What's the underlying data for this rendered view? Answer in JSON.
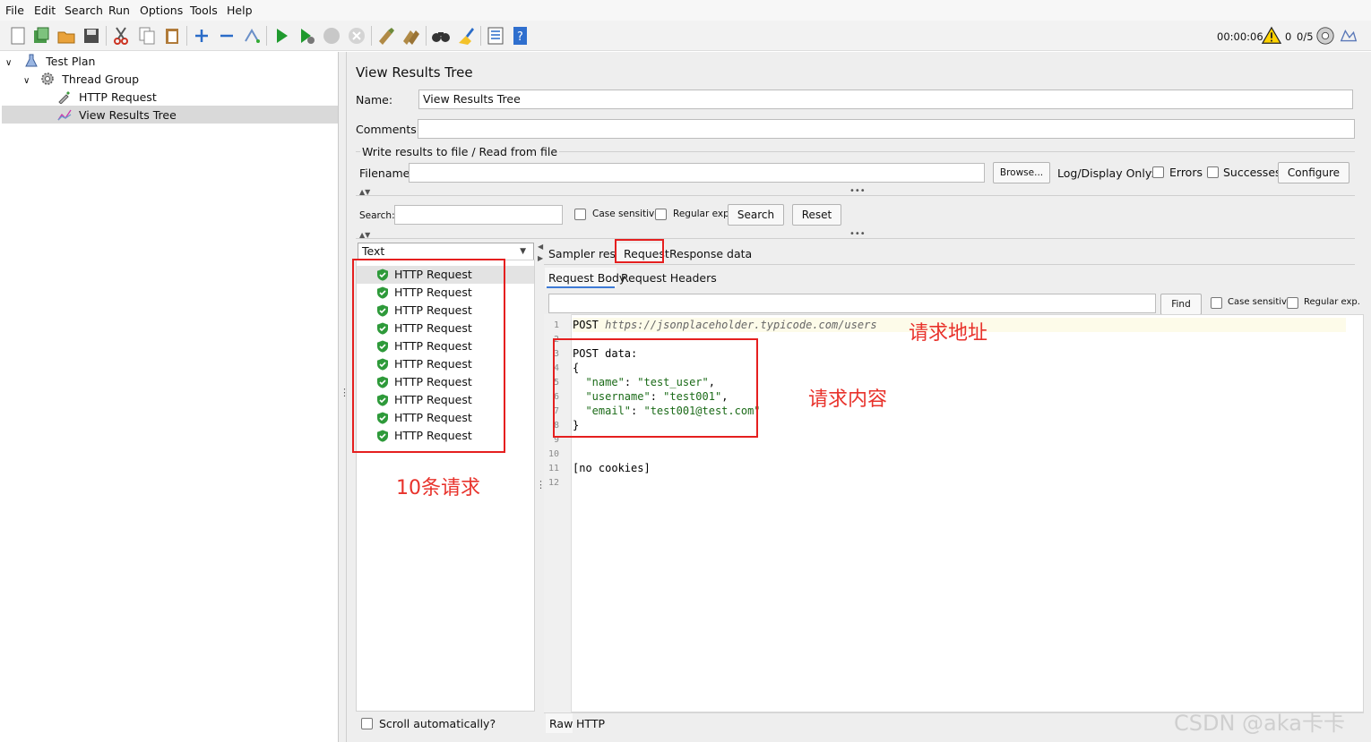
{
  "menu": [
    "File",
    "Edit",
    "Search",
    "Run",
    "Options",
    "Tools",
    "Help"
  ],
  "toolbar": {
    "timer": "00:00:06",
    "warnings": "0",
    "threads": "0/5"
  },
  "tree": {
    "test_plan": "Test Plan",
    "thread_group": "Thread Group",
    "http_request": "HTTP Request",
    "view_results_tree": "View Results Tree"
  },
  "panel": {
    "title": "View Results Tree",
    "name_label": "Name:",
    "name_value": "View Results Tree",
    "comments_label": "Comments:",
    "comments_value": "",
    "file_section": "Write results to file / Read from file",
    "filename_label": "Filename",
    "filename_value": "",
    "browse_button": "Browse...",
    "log_display_only": "Log/Display Only:",
    "errors_label": "Errors",
    "successes_label": "Successes",
    "configure_button": "Configure"
  },
  "search": {
    "label": "Search:",
    "value": "",
    "case_sensitive": "Case sensitive",
    "regular_exp": "Regular exp.",
    "search_button": "Search",
    "reset_button": "Reset"
  },
  "renderer": {
    "selected": "Text"
  },
  "results": [
    "HTTP Request",
    "HTTP Request",
    "HTTP Request",
    "HTTP Request",
    "HTTP Request",
    "HTTP Request",
    "HTTP Request",
    "HTTP Request",
    "HTTP Request",
    "HTTP Request"
  ],
  "scroll_auto": "Scroll automatically?",
  "tabs": {
    "sampler_result": "Sampler result",
    "request": "Request",
    "response_data": "Response data"
  },
  "subtabs": {
    "request_body": "Request Body",
    "request_headers": "Request Headers"
  },
  "find": {
    "value": "",
    "find_button": "Find",
    "case_sensitive": "Case sensitive",
    "regular_exp": "Regular exp."
  },
  "code": {
    "line_numbers": [
      "1",
      "2",
      "3",
      "4",
      "5",
      "6",
      "7",
      "8",
      "9",
      "10",
      "11",
      "12"
    ],
    "line1_method": "POST ",
    "line1_url": "https://jsonplaceholder.typicode.com/users",
    "line3": "POST data:",
    "line4": "{",
    "line5_key": "\"name\"",
    "line5_val": "\"test_user\"",
    "line6_key": "\"username\"",
    "line6_val": "\"test001\"",
    "line7_key": "\"email\"",
    "line7_val": "\"test001@test.com\"",
    "line8": "}",
    "line11": "[no cookies]"
  },
  "bottom_tabs": {
    "raw": "Raw",
    "http": "HTTP"
  },
  "annotations": {
    "request_url": "请求地址",
    "request_content": "请求内容",
    "ten_requests": "10条请求"
  },
  "watermark": "CSDN @aka卡卡",
  "colors": {
    "annotation_red": "#e8322b",
    "success_green": "#2e9a3a",
    "selection_gray": "#d9d9d9"
  }
}
